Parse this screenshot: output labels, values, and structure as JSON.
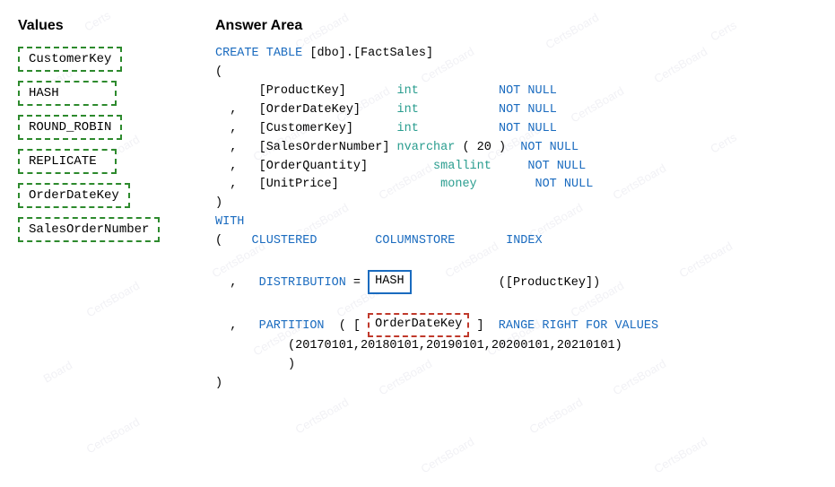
{
  "left": {
    "title": "Values",
    "items": [
      "CustomerKey",
      "HASH",
      "ROUND_ROBIN",
      "REPLICATE",
      "OrderDateKey",
      "SalesOrderNumber"
    ]
  },
  "right": {
    "title": "Answer Area",
    "watermarks": [
      "CertsBoard",
      "Certs",
      "Board"
    ]
  }
}
